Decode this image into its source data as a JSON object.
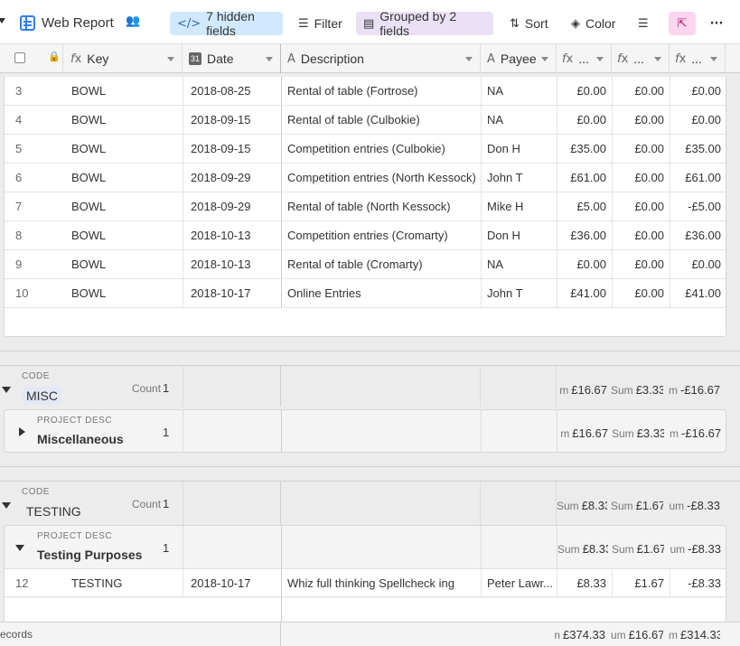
{
  "toolbar": {
    "view_name": "Web Report",
    "hidden_fields": "7 hidden fields",
    "filter": "Filter",
    "grouped": "Grouped by 2 fields",
    "sort": "Sort",
    "color": "Color"
  },
  "header": {
    "key": "Key",
    "date": "Date",
    "description": "Description",
    "payee": "Payee",
    "f1": "...",
    "f2": "...",
    "f3": "..."
  },
  "rows": [
    {
      "n": "3",
      "key": "BOWL",
      "date": "2018-08-25",
      "desc": "Rental of table (Fortrose)",
      "payee": "NA",
      "a": "£0.00",
      "b": "£0.00",
      "c": "£0.00"
    },
    {
      "n": "4",
      "key": "BOWL",
      "date": "2018-09-15",
      "desc": "Rental of table (Culbokie)",
      "payee": "NA",
      "a": "£0.00",
      "b": "£0.00",
      "c": "£0.00"
    },
    {
      "n": "5",
      "key": "BOWL",
      "date": "2018-09-15",
      "desc": "Competition entries (Culbokie)",
      "payee": "Don H",
      "a": "£35.00",
      "b": "£0.00",
      "c": "£35.00"
    },
    {
      "n": "6",
      "key": "BOWL",
      "date": "2018-09-29",
      "desc": "Competition entries (North Kessock)",
      "payee": "John T",
      "a": "£61.00",
      "b": "£0.00",
      "c": "£61.00"
    },
    {
      "n": "7",
      "key": "BOWL",
      "date": "2018-09-29",
      "desc": "Rental of table (North Kessock)",
      "payee": "Mike H",
      "a": "£5.00",
      "b": "£0.00",
      "c": "-£5.00"
    },
    {
      "n": "8",
      "key": "BOWL",
      "date": "2018-10-13",
      "desc": "Competition entries (Cromarty)",
      "payee": "Don H",
      "a": "£36.00",
      "b": "£0.00",
      "c": "£36.00"
    },
    {
      "n": "9",
      "key": "BOWL",
      "date": "2018-10-13",
      "desc": "Rental of table (Cromarty)",
      "payee": "NA",
      "a": "£0.00",
      "b": "£0.00",
      "c": "£0.00"
    },
    {
      "n": "10",
      "key": "BOWL",
      "date": "2018-10-17",
      "desc": "Online Entries",
      "payee": "John T",
      "a": "£41.00",
      "b": "£0.00",
      "c": "£41.00"
    }
  ],
  "groups": {
    "misc": {
      "code_label": "CODE",
      "code": "MISC",
      "count_label": "Count",
      "count": "1",
      "sum_a_prefix": "m",
      "sum_a": "£16.67",
      "sum_b_prefix": "Sum",
      "sum_b": "£3.33",
      "sum_c_prefix": "m",
      "sum_c": "-£16.67",
      "sub": {
        "label": "PROJECT DESC",
        "name": "Miscellaneous",
        "count": "1",
        "sum_a_prefix": "m",
        "sum_a": "£16.67",
        "sum_b_prefix": "Sum",
        "sum_b": "£3.33",
        "sum_c_prefix": "m",
        "sum_c": "-£16.67"
      }
    },
    "testing": {
      "code_label": "CODE",
      "code": "TESTING",
      "count_label": "Count",
      "count": "1",
      "sum_a_prefix": "Sum",
      "sum_a": "£8.33",
      "sum_b_prefix": "Sum",
      "sum_b": "£1.67",
      "sum_c_prefix": "um",
      "sum_c": "-£8.33",
      "sub": {
        "label": "PROJECT DESC",
        "name": "Testing Purposes",
        "count": "1",
        "sum_a_prefix": "Sum",
        "sum_a": "£8.33",
        "sum_b_prefix": "Sum",
        "sum_b": "£1.67",
        "sum_c_prefix": "um",
        "sum_c": "-£8.33"
      },
      "row": {
        "n": "12",
        "key": "TESTING",
        "date": "2018-10-17",
        "desc": "Whiz full thinking Spellcheck ing",
        "payee": "Peter Lawr...",
        "a": "£8.33",
        "b": "£1.67",
        "c": "-£8.33"
      }
    }
  },
  "footer": {
    "records": "ecords",
    "sum_a_prefix": "n",
    "sum_a": "£374.33",
    "sum_b_prefix": "um",
    "sum_b": "£16.67",
    "sum_c_prefix": "m",
    "sum_c": "£314.33"
  }
}
